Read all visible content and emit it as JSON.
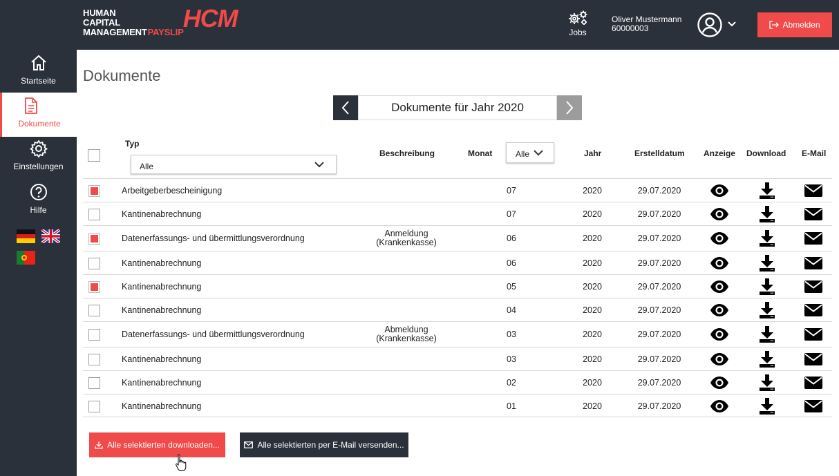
{
  "header": {
    "logo": {
      "line1": "HUMAN",
      "line2": "CAPITAL",
      "line3": "MANAGEMENT",
      "payslip": "PAYSLIP",
      "hcm": "HCM"
    },
    "jobs_label": "Jobs",
    "user_name": "Oliver Mustermann",
    "user_id": "60000003",
    "logout_label": "Abmelden"
  },
  "sidebar": {
    "items": [
      {
        "label": "Startseite",
        "icon": "home-icon"
      },
      {
        "label": "Dokumente",
        "icon": "document-icon"
      },
      {
        "label": "Einstellungen",
        "icon": "gear-icon"
      },
      {
        "label": "Hilfe",
        "icon": "help-icon"
      }
    ],
    "languages": [
      "de",
      "en",
      "pt"
    ]
  },
  "main": {
    "title": "Dokumente",
    "year_label": "Dokumente für Jahr 2020"
  },
  "table": {
    "headers": {
      "typ": "Typ",
      "beschreibung": "Beschreibung",
      "monat": "Monat",
      "jahr": "Jahr",
      "erstelldatum": "Erstelldatum",
      "anzeige": "Anzeige",
      "download": "Download",
      "email": "E-Mail"
    },
    "typ_filter": "Alle",
    "monat_filter": "Alle",
    "rows": [
      {
        "checked": true,
        "typ": "Arbeitgeberbescheinigung",
        "desc1": "",
        "desc2": "",
        "monat": "07",
        "jahr": "2020",
        "datum": "29.07.2020"
      },
      {
        "checked": false,
        "typ": "Kantinenabrechnung",
        "desc1": "",
        "desc2": "",
        "monat": "07",
        "jahr": "2020",
        "datum": "29.07.2020"
      },
      {
        "checked": true,
        "typ": "Datenerfassungs- und übermittlungsverordnung",
        "desc1": "Anmeldung",
        "desc2": "(Krankenkasse)",
        "monat": "06",
        "jahr": "2020",
        "datum": "29.07.2020"
      },
      {
        "checked": false,
        "typ": "Kantinenabrechnung",
        "desc1": "",
        "desc2": "",
        "monat": "06",
        "jahr": "2020",
        "datum": "29.07.2020"
      },
      {
        "checked": true,
        "typ": "Kantinenabrechnung",
        "desc1": "",
        "desc2": "",
        "monat": "05",
        "jahr": "2020",
        "datum": "29.07.2020"
      },
      {
        "checked": false,
        "typ": "Kantinenabrechnung",
        "desc1": "",
        "desc2": "",
        "monat": "04",
        "jahr": "2020",
        "datum": "29.07.2020"
      },
      {
        "checked": false,
        "typ": "Datenerfassungs- und übermittlungsverordnung",
        "desc1": "Abmeldung",
        "desc2": "(Krankenkasse)",
        "monat": "03",
        "jahr": "2020",
        "datum": "29.07.2020"
      },
      {
        "checked": false,
        "typ": "Kantinenabrechnung",
        "desc1": "",
        "desc2": "",
        "monat": "03",
        "jahr": "2020",
        "datum": "29.07.2020"
      },
      {
        "checked": false,
        "typ": "Kantinenabrechnung",
        "desc1": "",
        "desc2": "",
        "monat": "02",
        "jahr": "2020",
        "datum": "29.07.2020"
      },
      {
        "checked": false,
        "typ": "Kantinenabrechnung",
        "desc1": "",
        "desc2": "",
        "monat": "01",
        "jahr": "2020",
        "datum": "29.07.2020"
      }
    ]
  },
  "actions": {
    "download_selected": "Alle selektierten downloaden...",
    "email_selected": "Alle selektierten per E-Mail versenden..."
  },
  "colors": {
    "accent": "#f04a4a",
    "dark": "#2b313b",
    "grey_button": "#9c9c9c"
  }
}
